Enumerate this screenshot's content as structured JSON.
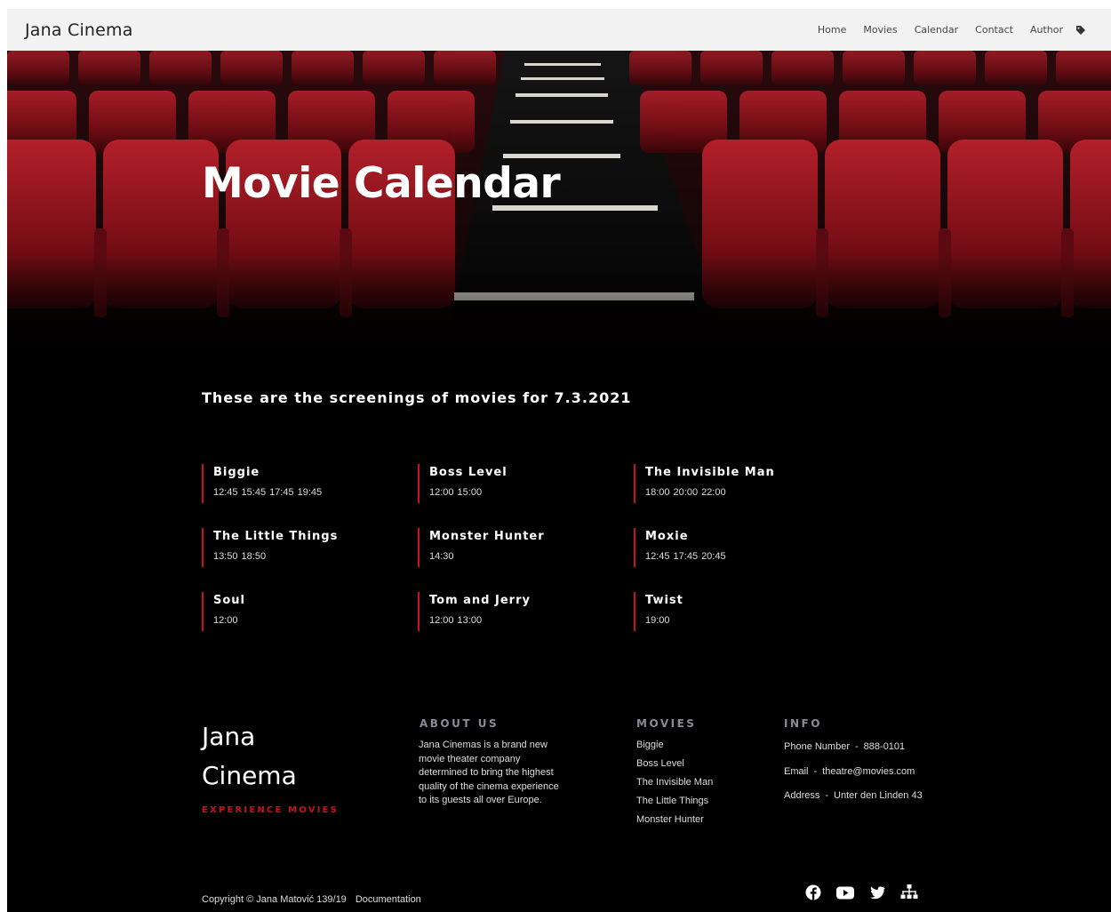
{
  "navbar": {
    "brand": "Jana Cinema",
    "links": [
      "Home",
      "Movies",
      "Calendar",
      "Contact",
      "Author"
    ],
    "icons": [
      "tag-icon"
    ]
  },
  "hero": {
    "title": "Movie Calendar"
  },
  "screenings": {
    "heading": "These are the screenings of movies for 7.3.2021",
    "movies": [
      {
        "title": "Biggie",
        "times": [
          "12:45",
          "15:45",
          "17:45",
          "19:45"
        ]
      },
      {
        "title": "Boss Level",
        "times": [
          "12:00",
          "15:00"
        ]
      },
      {
        "title": "The Invisible Man",
        "times": [
          "18:00",
          "20:00",
          "22:00"
        ]
      },
      {
        "title": "The Little Things",
        "times": [
          "13:50",
          "18:50"
        ]
      },
      {
        "title": "Monster Hunter",
        "times": [
          "14:30"
        ]
      },
      {
        "title": "Moxie",
        "times": [
          "12:45",
          "17:45",
          "20:45"
        ]
      },
      {
        "title": "Soul",
        "times": [
          "12:00"
        ]
      },
      {
        "title": "Tom and Jerry",
        "times": [
          "12:00",
          "13:00"
        ]
      },
      {
        "title": "Twist",
        "times": [
          "19:00"
        ]
      }
    ],
    "accent_color": "#c8121b"
  },
  "footer": {
    "logo_line1": "Jana",
    "logo_line2": "Cinema",
    "tagline": "EXPERIENCE MOVIES",
    "about": {
      "heading": "ABOUT US",
      "text": "Jana Cinemas is a brand new movie theater company determined to bring the highest quality of the cinema experience to its guests all over Europe."
    },
    "movies": {
      "heading": "MOVIES",
      "items": [
        "Biggie",
        "Boss Level",
        "The Invisible Man",
        "The Little Things",
        "Monster Hunter"
      ]
    },
    "info": {
      "heading": "INFO",
      "phone_label": "Phone Number",
      "phone": "888-0101",
      "email_label": "Email",
      "email": "theatre@movies.com",
      "address_label": "Address",
      "address": "Unter den Linden 43",
      "separator": "-"
    },
    "copyright": "Copyright © Jana Matović 139/19",
    "documentation": "Documentation",
    "socials": [
      "facebook-icon",
      "youtube-icon",
      "twitter-icon",
      "sitemap-icon"
    ]
  }
}
